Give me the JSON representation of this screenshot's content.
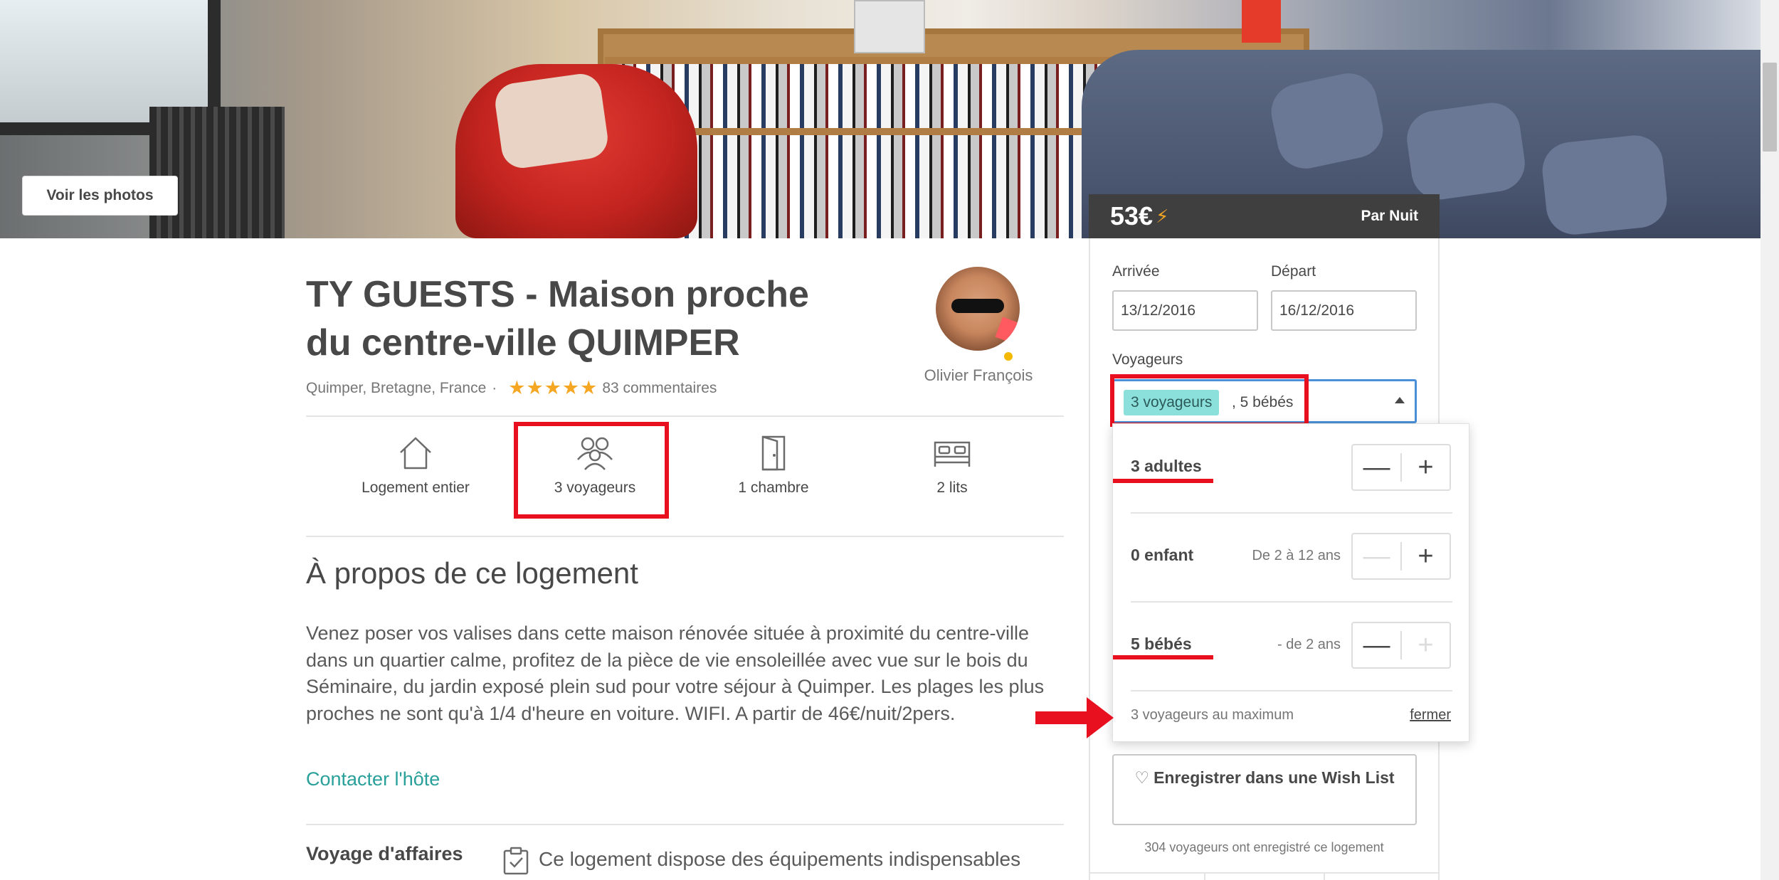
{
  "hero": {
    "photos_button": "Voir les photos"
  },
  "listing": {
    "title": "TY GUESTS - Maison proche du centre-ville QUIMPER",
    "location": "Quimper, Bretagne, France",
    "separator": "·",
    "stars": "★★★★★",
    "rating_stars": 5,
    "reviews": "83 commentaires"
  },
  "host": {
    "name": "Olivier François"
  },
  "amenities": [
    {
      "icon": "house-icon",
      "label": "Logement entier"
    },
    {
      "icon": "people-icon",
      "label": "3 voyageurs"
    },
    {
      "icon": "door-icon",
      "label": "1 chambre"
    },
    {
      "icon": "bed-icon",
      "label": "2 lits"
    }
  ],
  "about": {
    "heading": "À propos de ce logement",
    "text": "Venez poser vos valises dans cette maison rénovée située à proximité du centre-ville dans un quartier calme, profitez de la pièce de vie ensoleillée avec vue sur le bois du Séminaire, du jardin exposé plein sud pour votre séjour à Quimper. Les plages les plus proches ne sont qu'à 1/4 d'heure en voiture. WIFI. A partir de 46€/nuit/2pers.",
    "contact": "Contacter l'hôte"
  },
  "business": {
    "label": "Voyage d'affaires",
    "text": "Ce logement dispose des équipements indispensables"
  },
  "booking": {
    "price": "53€",
    "bolt": "⚡",
    "per_night": "Par Nuit",
    "checkin_label": "Arrivée",
    "checkin_value": "13/12/2016",
    "checkout_label": "Départ",
    "checkout_value": "16/12/2016",
    "guests_label": "Voyageurs",
    "guests_chip": "3 voyageurs",
    "guests_rest": ", 5 bébés",
    "wishlist": "Enregistrer dans une Wish List",
    "wishlist_heart": "♡",
    "saved_note": "304 voyageurs ont enregistré ce logement"
  },
  "guests_popover": {
    "rows": [
      {
        "label": "3 adultes",
        "sub": ""
      },
      {
        "label": "0 enfant",
        "sub": "De 2 à 12 ans"
      },
      {
        "label": "5 bébés",
        "sub": "- de 2 ans"
      }
    ],
    "minus": "—",
    "plus": "+",
    "max_note": "3 voyageurs au maximum",
    "close": "fermer"
  },
  "colors": {
    "annotation_red": "#e8101f",
    "accent_teal": "#2aa09a",
    "chip": "#8be0dc",
    "star": "#f5a623",
    "focus_blue": "#4a90d9"
  }
}
